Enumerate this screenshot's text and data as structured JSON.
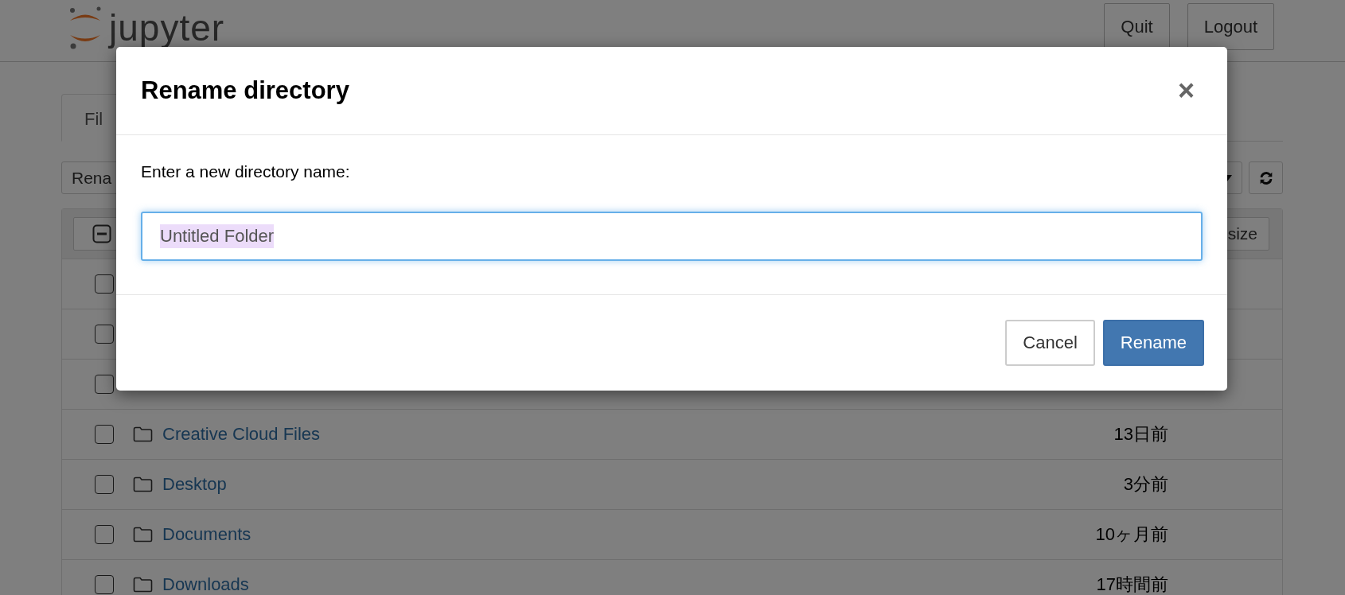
{
  "header": {
    "logo_text": "jupyter",
    "buttons": [
      "Quit",
      "Logout"
    ]
  },
  "tabs": [
    {
      "label": "Fil",
      "selected": true
    }
  ],
  "toolbar": {
    "action_button": "Rena"
  },
  "table": {
    "header": {
      "select_all_indeterminate": true,
      "sort_button": "size"
    },
    "rows": [
      {
        "checked": false
      },
      {
        "checked": false
      },
      {
        "checked": false
      },
      {
        "checked": false,
        "name": "Creative Cloud Files",
        "modified": "13日前"
      },
      {
        "checked": false,
        "name": "Desktop",
        "modified": "3分前"
      },
      {
        "checked": false,
        "name": "Documents",
        "modified": "10ヶ月前"
      },
      {
        "checked": false,
        "name": "Downloads",
        "modified": "17時間前"
      }
    ]
  },
  "dialog": {
    "title": "Rename directory",
    "close": "×",
    "prompt": "Enter a new directory name:",
    "input": {
      "value": "Untitled Folder",
      "text_selected": true
    },
    "buttons": [
      {
        "label": "Cancel",
        "kind": "default"
      },
      {
        "label": "Rename",
        "kind": "primary"
      }
    ]
  }
}
